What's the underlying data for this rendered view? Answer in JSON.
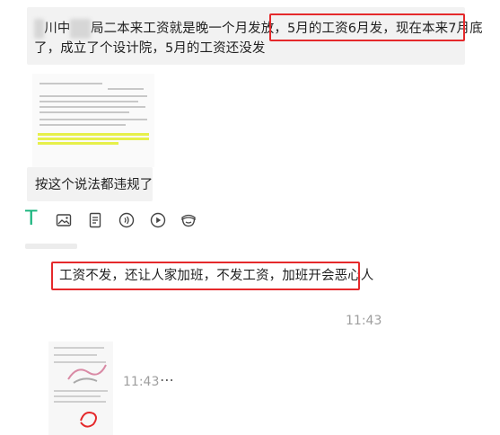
{
  "messages": [
    {
      "line1_prefix": "川中",
      "line1_middle": "局二本来工资就是晚一个月发放，",
      "line1_highlight": "5月的工资6月发，现在本来7月底",
      "line2": "了，成立了个设计院，5月的工资还没发"
    },
    {
      "text": "按这个说法都违规了"
    }
  ],
  "toolbar": {
    "text_icon": "T",
    "icons": [
      "image-icon",
      "document-icon",
      "audio-icon",
      "play-icon",
      "emoji-icon"
    ]
  },
  "reply": {
    "text": "工资不发，还让人家加班，不发工资，加班开会恶心人"
  },
  "timestamps": {
    "first": "11:43",
    "second": "11:43"
  },
  "more_icon": "⋯",
  "colors": {
    "highlight_border": "#e5292b",
    "accent_green": "#15b37b",
    "bubble_bg": "#f2f2f2",
    "timestamp": "#9e9e9e"
  }
}
